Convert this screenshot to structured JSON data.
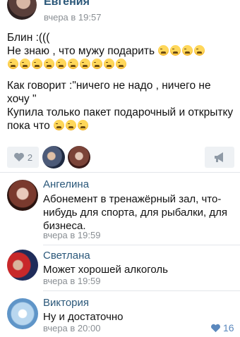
{
  "post": {
    "author": "Евгения",
    "time": "вчера в 19:57",
    "paragraphs": [
      "Блин :(((",
      "Не знаю , что мужу подарить",
      "Как говорит :\"ничего не надо , ничего не хочу \"",
      "Купила только пакет подарочный и открытку пока что"
    ],
    "emoji": "weary-face"
  },
  "actions": {
    "like_count": "2",
    "like_icon": "heart-icon",
    "share_icon": "megaphone-icon"
  },
  "comments": [
    {
      "author": "Ангелина",
      "text": "Абонемент в тренажёрный зал, что-нибудь для спорта, для рыбалки, для бизнеса.",
      "time": "вчера в 19:59"
    },
    {
      "author": "Светлана",
      "text": "Может хорошей алкоголь",
      "time": "вчера в 19:59"
    },
    {
      "author": "Виктория",
      "text": "Ну и достаточно",
      "time": "вчера в 20:00",
      "likes": "16"
    }
  ],
  "colors": {
    "link": "#2b587a",
    "muted": "#8a8f94",
    "like_accent": "#5b88bd",
    "button_bg": "#eef1f4"
  }
}
